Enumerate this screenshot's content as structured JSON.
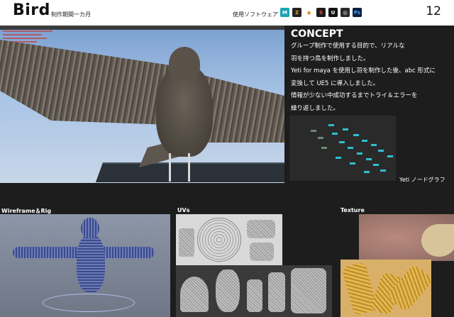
{
  "header": {
    "title": "Bird",
    "period": "制作期間一カ月",
    "software_label": "使用ソフトウェア",
    "page_number": "12",
    "software": [
      {
        "name": "maya-icon",
        "glyph": "M",
        "bg": "#1aa3b5",
        "fg": "#ffffff"
      },
      {
        "name": "zbrush-icon",
        "glyph": "Z",
        "bg": "#222222",
        "fg": "#f0a030"
      },
      {
        "name": "blender-icon",
        "glyph": "◉",
        "bg": "#ffffff",
        "fg": "#e87d0d"
      },
      {
        "name": "substance-icon",
        "glyph": "S",
        "bg": "#1a1a1a",
        "fg": "#e05a3a"
      },
      {
        "name": "unreal-icon",
        "glyph": "U",
        "bg": "#111111",
        "fg": "#ffffff"
      },
      {
        "name": "unreal-engine-icon",
        "glyph": "◎",
        "bg": "#2a2a2a",
        "fg": "#ffffff"
      },
      {
        "name": "photoshop-icon",
        "glyph": "Ps",
        "bg": "#0b1e3d",
        "fg": "#31a8ff"
      }
    ]
  },
  "concept": {
    "heading": "CONCEPT",
    "lines": [
      "グループ制作で使用する目的で、リアルな",
      "羽を持つ鳥を制作しました。",
      "Yeti for maya を使用し羽を制作した後、abc 形式に",
      "変換して UE5 に導入しました。",
      "情報が少ない中成功するまでトライ＆エラーを",
      "繰り返しました。"
    ]
  },
  "node_graph_label": "Yeti ノードグラフ",
  "sections": {
    "wireframe": "Wireframe＆Rig",
    "uvs": "UVs",
    "texture": "Texture"
  }
}
